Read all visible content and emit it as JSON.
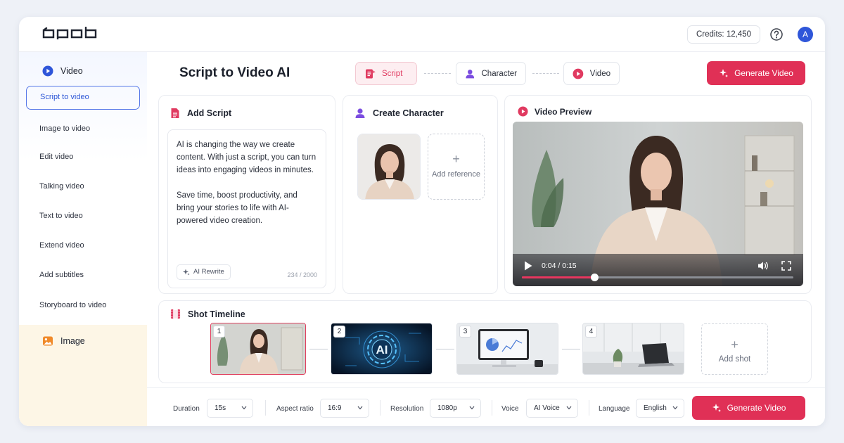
{
  "app": {
    "logo_text": "opob",
    "credits": "Credits: 12,450",
    "avatar_initial": "A"
  },
  "sidebar": {
    "video_section": "Video",
    "items": [
      {
        "label": "Script to video",
        "active": true
      },
      {
        "label": "Image to video"
      },
      {
        "label": "Edit video"
      },
      {
        "label": "Talking video"
      },
      {
        "label": "Text to video"
      },
      {
        "label": "Extend video"
      },
      {
        "label": "Add subtitles"
      },
      {
        "label": "Storyboard to video"
      }
    ],
    "image_section": "Image"
  },
  "header": {
    "title": "Script to Video AI",
    "steps": [
      {
        "label": "Script",
        "active": true,
        "icon": "script-doc-icon"
      },
      {
        "label": "Character",
        "icon": "person-icon"
      },
      {
        "label": "Video",
        "icon": "play-circle-icon"
      }
    ],
    "generate_label": "Generate Video"
  },
  "script_card": {
    "title": "Add Script",
    "paragraph1": "AI is changing the way we create content. With just a script, you can turn ideas into engaging videos in minutes.",
    "paragraph2": "Save time, boost productivity, and bring your stories to life with AI-powered video creation.",
    "rewrite_label": "AI Rewrite",
    "char_count": "234 / 2000"
  },
  "character_card": {
    "title": "Create Character",
    "add_reference_label": "Add reference"
  },
  "preview_card": {
    "title": "Video Preview",
    "time": "0:04 / 0:15",
    "progress": 0.267
  },
  "timeline": {
    "title": "Shot Timeline",
    "shots": [
      {
        "number": "1",
        "active": true
      },
      {
        "number": "2",
        "overlay_text": "AI"
      },
      {
        "number": "3"
      },
      {
        "number": "4"
      }
    ],
    "add_shot_label": "Add shot"
  },
  "options": {
    "duration": {
      "label": "Duration",
      "value": "15s"
    },
    "aspect_ratio": {
      "label": "Aspect ratio",
      "value": "16:9"
    },
    "resolution": {
      "label": "Resolution",
      "value": "1080p"
    },
    "voice": {
      "label": "Voice",
      "value": "AI Voice"
    },
    "language": {
      "label": "Language",
      "value": "English"
    },
    "generate_label": "Generate Video"
  },
  "colors": {
    "accent": "#e03056",
    "primary": "#2f56d9"
  }
}
